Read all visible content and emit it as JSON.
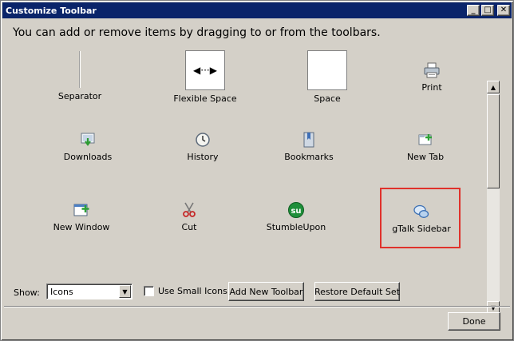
{
  "window": {
    "title": "Customize Toolbar"
  },
  "instructions": "You can add or remove items by dragging to or from the toolbars.",
  "items": [
    {
      "label": "Separator",
      "icon": "separator-icon"
    },
    {
      "label": "Flexible Space",
      "icon": "flexible-space-icon",
      "glyph": "◀···▶"
    },
    {
      "label": "Space",
      "icon": "space-icon"
    },
    {
      "label": "Print",
      "icon": "printer-icon"
    },
    {
      "label": "Downloads",
      "icon": "download-icon"
    },
    {
      "label": "History",
      "icon": "clock-icon"
    },
    {
      "label": "Bookmarks",
      "icon": "bookmark-icon"
    },
    {
      "label": "New Tab",
      "icon": "new-tab-icon"
    },
    {
      "label": "New Window",
      "icon": "new-window-icon"
    },
    {
      "label": "Cut",
      "icon": "scissors-icon"
    },
    {
      "label": "StumbleUpon",
      "icon": "stumbleupon-icon"
    },
    {
      "label": "gTalk Sidebar",
      "icon": "chat-bubble-icon"
    }
  ],
  "bottom": {
    "show_label": "Show:",
    "show_value": "Icons",
    "small_icons_label": "Use Small Icons",
    "small_icons_checked": false,
    "add_toolbar": "Add New Toolbar",
    "restore_default": "Restore Default Set"
  },
  "footer": {
    "done": "Done"
  },
  "colors": {
    "title_bar": "#0a246a",
    "dialog_bg": "#d4d0c8",
    "highlight": "#e0312b"
  }
}
